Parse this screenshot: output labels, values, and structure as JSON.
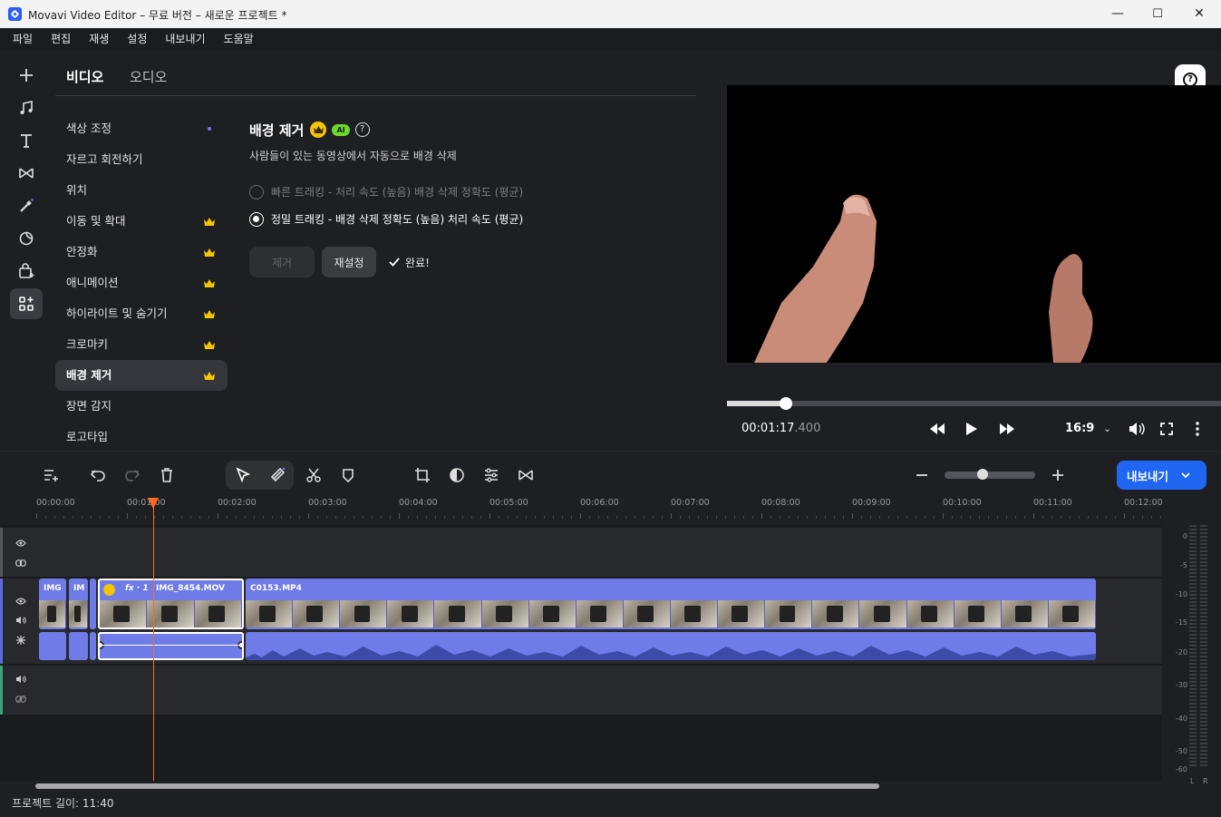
{
  "window": {
    "title": "Movavi Video Editor – 무료 버전 – 새로운 프로젝트 *",
    "minimize": "—",
    "maximize": "☐",
    "close": "✕"
  },
  "menu": [
    "파일",
    "편집",
    "재생",
    "설정",
    "내보내기",
    "도움말"
  ],
  "left_tools": [
    "add-icon",
    "music-icon",
    "text-icon",
    "transition-icon",
    "magic-wand-icon",
    "sticker-icon",
    "store-icon",
    "more-tools-icon"
  ],
  "tabs": {
    "video": "비디오",
    "audio": "오디오"
  },
  "categories": [
    {
      "label": "색상 조정",
      "badge": "dot"
    },
    {
      "label": "자르고 회전하기",
      "badge": ""
    },
    {
      "label": "위치",
      "badge": ""
    },
    {
      "label": "이동 및 확대",
      "badge": "crown"
    },
    {
      "label": "안정화",
      "badge": "crown"
    },
    {
      "label": "애니메이션",
      "badge": "crown"
    },
    {
      "label": "하이라이트 및 숨기기",
      "badge": "crown"
    },
    {
      "label": "크로마키",
      "badge": "crown"
    },
    {
      "label": "배경 제거",
      "badge": "crown",
      "active": true
    },
    {
      "label": "장면 감지",
      "badge": ""
    },
    {
      "label": "로고타입",
      "badge": ""
    }
  ],
  "effect": {
    "title": "배경 제거",
    "ai_badge": "AI",
    "help": "?",
    "description": "사람들이 있는 동영상에서 자동으로 배경 삭제",
    "option_fast": "빠른 트래킹 - 처리 속도 (높음) 배경 삭제 정확도 (평균)",
    "option_precise": "정밀 트래킹 - 배경 삭제 정확도 (높음) 처리 속도 (평균)",
    "selected_option": "precise",
    "remove_button": "제거",
    "reset_button": "재설정",
    "done_text": "완료!"
  },
  "player": {
    "timecode_main": "00:01:17",
    "timecode_ms": ".400",
    "aspect": "16:9",
    "progress": 0.12
  },
  "timeline": {
    "export_button": "내보내기",
    "zoom_level": 0.4,
    "ruler": [
      "00:00:00",
      "00:01:00",
      "00:02:00",
      "00:03:00",
      "00:04:00",
      "00:05:00",
      "00:06:00",
      "00:07:00",
      "00:08:00",
      "00:09:00",
      "00:10:00",
      "00:11:00",
      "00:12:00"
    ],
    "clips": {
      "c1": "IMG",
      "c2": "IM",
      "c3": "IMG_8454.MOV",
      "c3_fx": "fx · 1",
      "c4": "C0153.MP4"
    },
    "meter_labels": [
      "0",
      "-5",
      "-10",
      "-15",
      "-20",
      "-30",
      "-40",
      "-50",
      "-60"
    ],
    "meter_channels": [
      "L",
      "R"
    ]
  },
  "status": {
    "project_length": "프로젝트 길이: 11:40"
  },
  "colors": {
    "accent": "#1f66f2",
    "clip": "#6f7ce8",
    "playhead": "#ff6a1a",
    "crown": "#f3c400",
    "ai": "#6ad82b"
  }
}
